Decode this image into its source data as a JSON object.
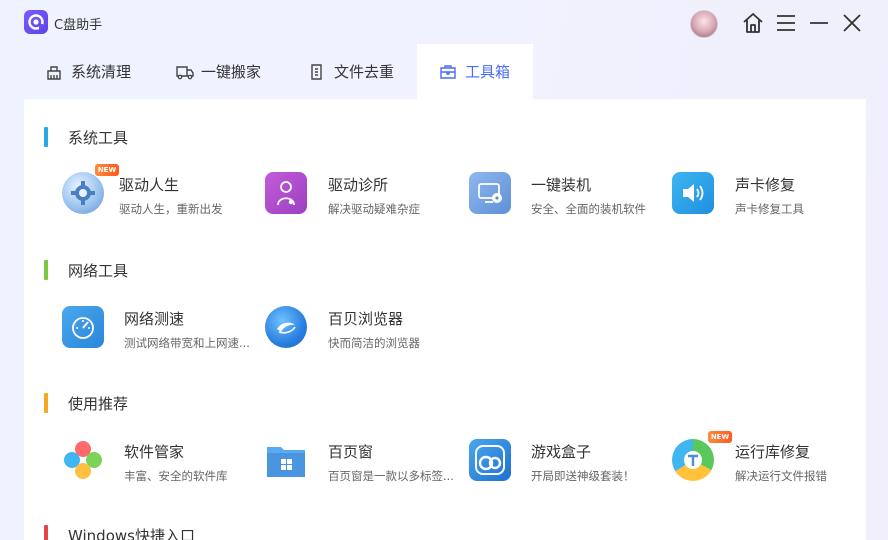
{
  "app": {
    "title": "C盘助手"
  },
  "tabs": [
    {
      "label": "系统清理",
      "icon": "broom-icon"
    },
    {
      "label": "一键搬家",
      "icon": "truck-icon"
    },
    {
      "label": "文件去重",
      "icon": "file-duplicate-icon"
    },
    {
      "label": "工具箱",
      "icon": "toolbox-icon",
      "active": true
    }
  ],
  "sections": [
    {
      "title": "系统工具",
      "color": "#2aa8e0",
      "tools": [
        {
          "name": "驱动人生",
          "desc": "驱动人生，重新出发",
          "badge": "NEW"
        },
        {
          "name": "驱动诊所",
          "desc": "解决驱动疑难杂症"
        },
        {
          "name": "一键装机",
          "desc": "安全、全面的装机软件"
        },
        {
          "name": "声卡修复",
          "desc": "声卡修复工具"
        }
      ]
    },
    {
      "title": "网络工具",
      "color": "#7ac943",
      "tools": [
        {
          "name": "网络测速",
          "desc": "测试网络带宽和上网速..."
        },
        {
          "name": "百贝浏览器",
          "desc": "快而简洁的浏览器"
        }
      ]
    },
    {
      "title": "使用推荐",
      "color": "#f5a623",
      "tools": [
        {
          "name": "软件管家",
          "desc": "丰富、安全的软件库"
        },
        {
          "name": "百页窗",
          "desc": "百页窗是一款以多标签..."
        },
        {
          "name": "游戏盒子",
          "desc": "开局即送神级套装！"
        },
        {
          "name": "运行库修复",
          "desc": "解决运行文件报错",
          "badge": "NEW"
        }
      ]
    },
    {
      "title": "Windows快捷入口",
      "color": "#e04848",
      "tools": []
    }
  ]
}
